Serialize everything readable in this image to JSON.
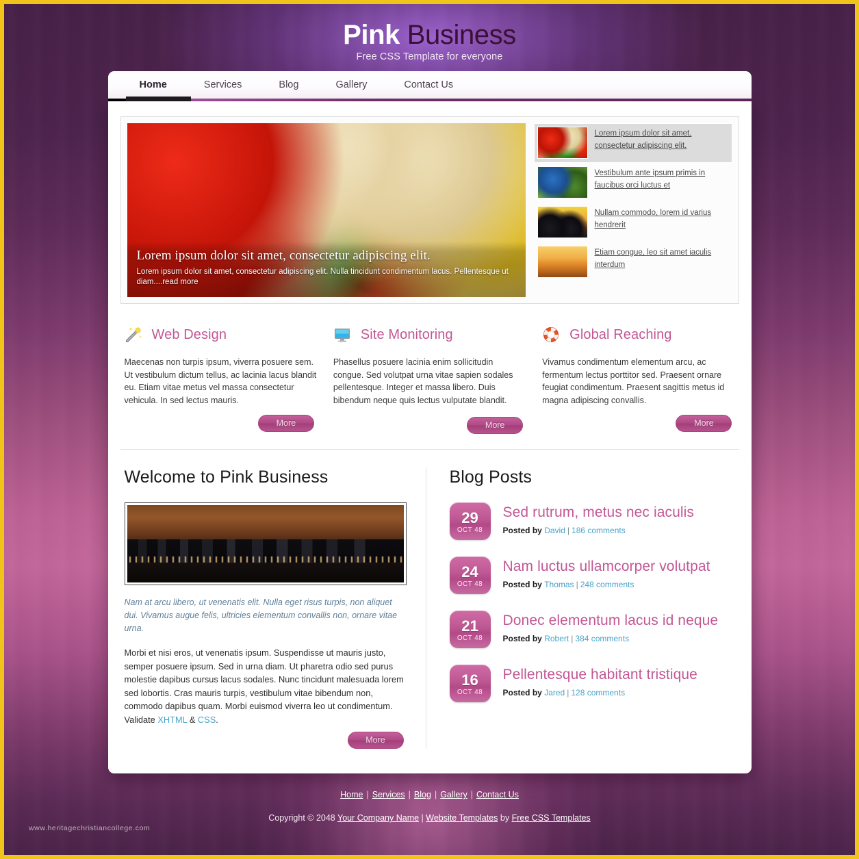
{
  "header": {
    "logo_first": "Pink",
    "logo_second": " Business",
    "tagline": "Free CSS Template for everyone"
  },
  "nav": {
    "items": [
      {
        "label": "Home",
        "active": true
      },
      {
        "label": "Services",
        "active": false
      },
      {
        "label": "Blog",
        "active": false
      },
      {
        "label": "Gallery",
        "active": false
      },
      {
        "label": "Contact Us",
        "active": false
      }
    ]
  },
  "slider": {
    "caption_title": "Lorem ipsum dolor sit amet, consectetur adipiscing elit.",
    "caption_text": "Lorem ipsum dolor sit amet, consectetur adipiscing elit. Nulla tincidunt condimentum lacus. Pellentesque ut diam....",
    "read_more": "read more",
    "thumbs": [
      {
        "text": "Lorem ipsum dolor sit amet, consectetur adipiscing elit.",
        "icon": "peppers-thumbnail",
        "active": true
      },
      {
        "text": "Vestibulum ante ipsum primis in faucibus orci luctus et",
        "icon": "bird-thumbnail",
        "active": false
      },
      {
        "text": "Nullam commodo, lorem id varius hendrerit",
        "icon": "berries-thumbnail",
        "active": false
      },
      {
        "text": "Etiam congue, leo sit amet iaculis interdum",
        "icon": "sunset-thumbnail",
        "active": false
      }
    ]
  },
  "features": [
    {
      "icon": "magic-wand-icon",
      "title": "Web Design",
      "text": "Maecenas non turpis ipsum, viverra posuere sem. Ut vestibulum dictum tellus, ac lacinia lacus blandit eu. Etiam vitae metus vel massa consectetur vehicula. In sed lectus mauris.",
      "button": "More"
    },
    {
      "icon": "monitor-icon",
      "title": "Site Monitoring",
      "text": "Phasellus posuere lacinia enim sollicitudin congue. Sed volutpat urna vitae sapien sodales pellentesque. Integer et massa libero. Duis bibendum neque quis lectus vulputate blandit.",
      "button": "More"
    },
    {
      "icon": "lifebuoy-icon",
      "title": "Global Reaching",
      "text": "Vivamus condimentum elementum arcu, ac fermentum lectus porttitor sed. Praesent ornare feugiat condimentum. Praesent sagittis metus id magna adipiscing convallis.",
      "button": "More"
    }
  ],
  "welcome": {
    "title": "Welcome to Pink Business",
    "image_alt": "city-skyline-photo",
    "intro": "Nam at arcu libero, ut venenatis elit. Nulla eget risus turpis, non aliquet dui. Vivamus augue felis, ultricies elementum convallis non, ornare vitae urna.",
    "body_before": "Morbi et nisi eros, ut venenatis ipsum. Suspendisse ut mauris justo, semper posuere ipsum. Sed in urna diam. Ut pharetra odio sed purus molestie dapibus cursus lacus sodales. Nunc tincidunt malesuada lorem sed lobortis. Cras mauris turpis, vestibulum vitae bibendum non, commodo dapibus quam. Morbi euismod viverra leo ut condimentum. Validate ",
    "link_xhtml": "XHTML",
    "body_amp": " & ",
    "link_css": "CSS",
    "body_end": ".",
    "button": "More"
  },
  "blog": {
    "title": "Blog Posts",
    "posted_by": "Posted by",
    "posts": [
      {
        "day": "29",
        "month": "OCT 48",
        "title": "Sed rutrum, metus nec iaculis",
        "author": "David",
        "comments": "186 comments"
      },
      {
        "day": "24",
        "month": "OCT 48",
        "title": "Nam luctus ullamcorper volutpat",
        "author": "Thomas",
        "comments": "248 comments"
      },
      {
        "day": "21",
        "month": "OCT 48",
        "title": "Donec elementum lacus id neque",
        "author": "Robert",
        "comments": "384 comments"
      },
      {
        "day": "16",
        "month": "OCT 48",
        "title": "Pellentesque habitant tristique",
        "author": "Jared",
        "comments": "128 comments"
      }
    ]
  },
  "footer": {
    "nav": [
      "Home",
      "Services",
      "Blog",
      "Gallery",
      "Contact Us"
    ],
    "copy_prefix": "Copyright © 2048 ",
    "company": "Your Company Name",
    "copy_mid": " | ",
    "templates_link": "Website Templates",
    "copy_by": " by ",
    "credit_link": "Free CSS Templates"
  },
  "watermark": "www.heritagechristiancollege.com",
  "colors": {
    "accent_pink": "#c25795",
    "button_pink": "#b04a86",
    "link_blue": "#49a3c9",
    "frame_gold": "#f0c419"
  }
}
